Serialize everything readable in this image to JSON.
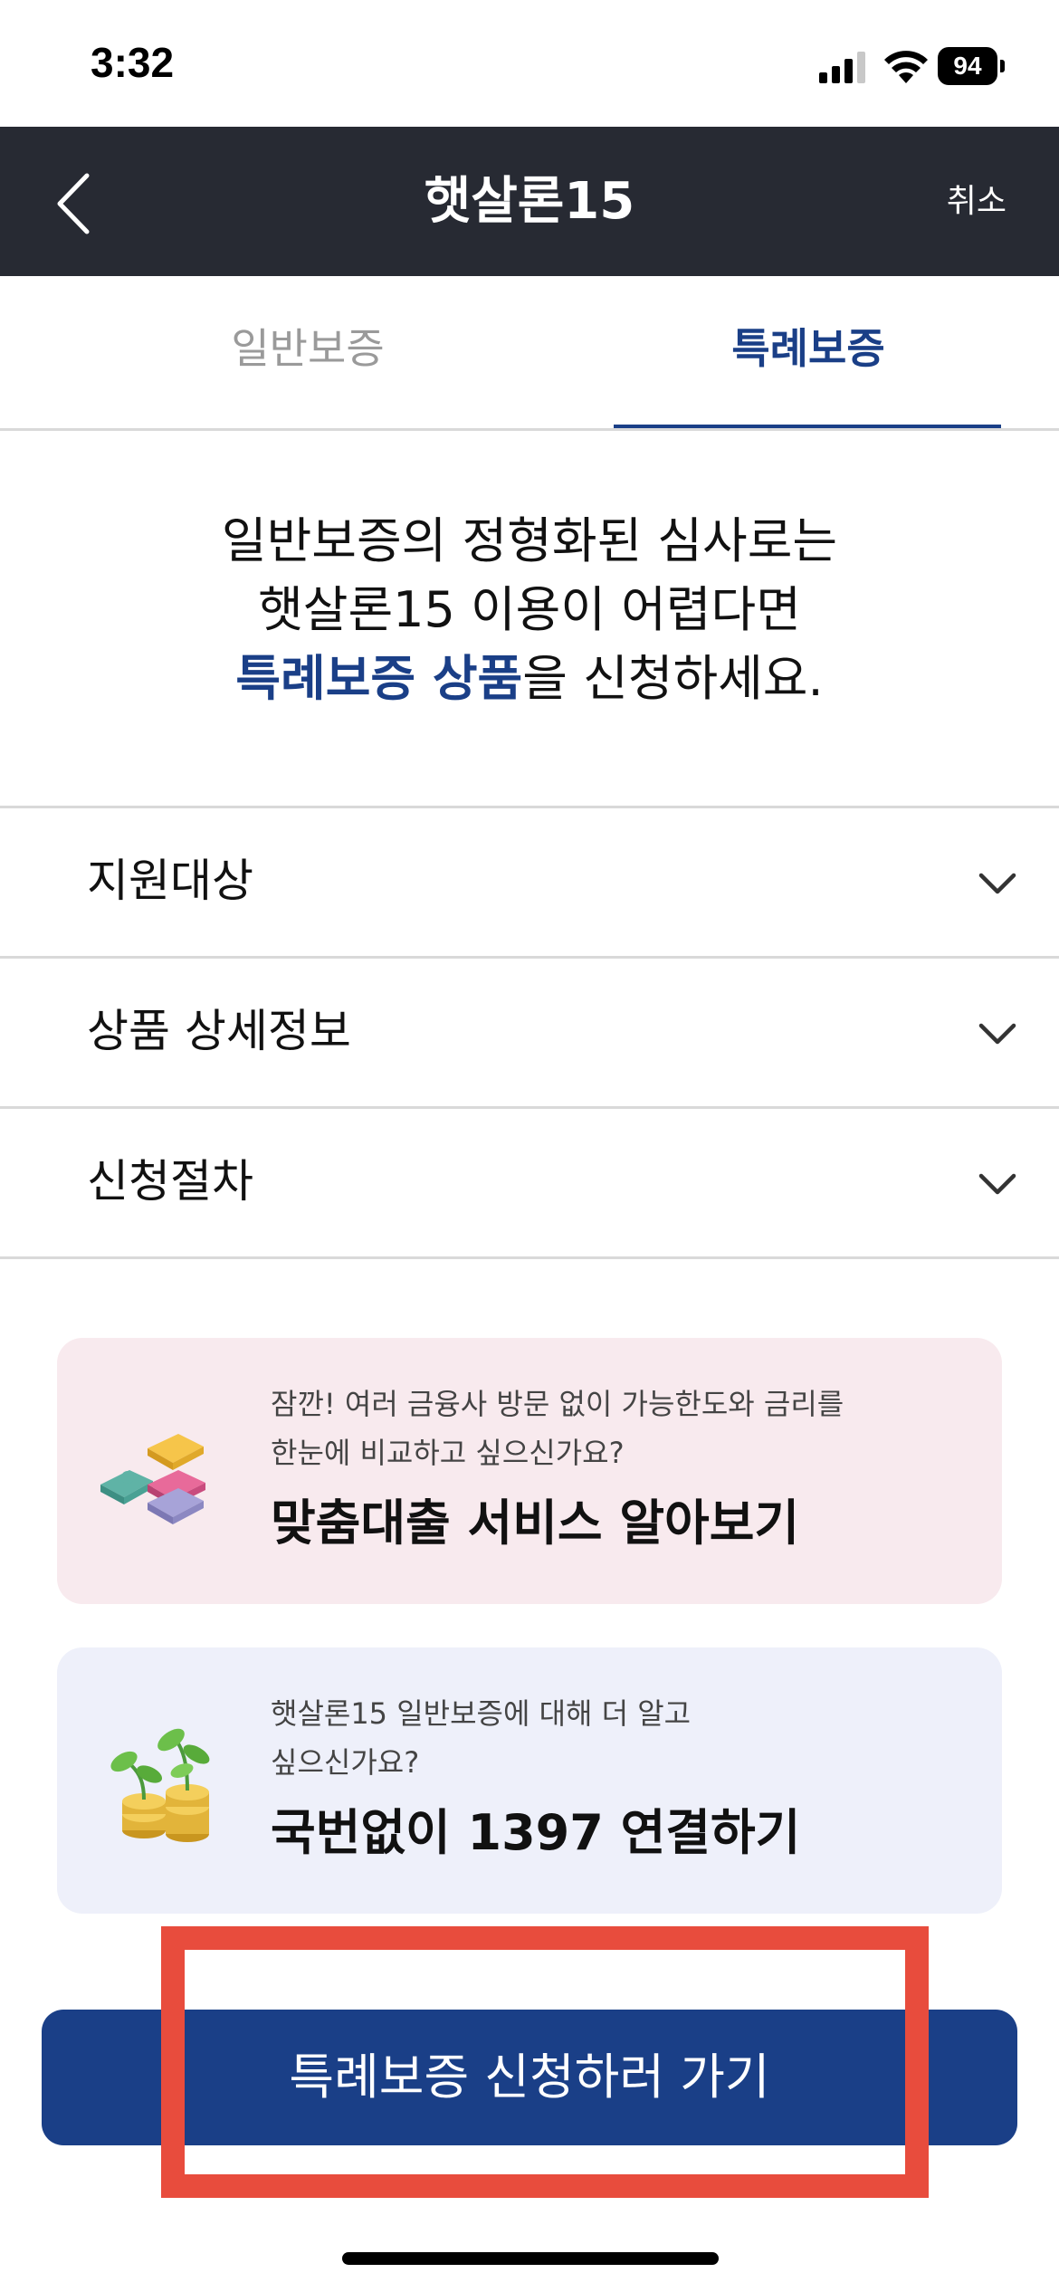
{
  "status_bar": {
    "time": "3:32",
    "battery": "94"
  },
  "header": {
    "title": "햇살론15",
    "cancel_label": "취소",
    "back_icon": "chevron-left-icon"
  },
  "tabs": [
    {
      "label": "일반보증",
      "active": false
    },
    {
      "label": "특례보증",
      "active": true
    }
  ],
  "intro": {
    "line1": "일반보증의 정형화된 심사로는",
    "line2": "햇살론15 이용이 어렵다면",
    "line3_highlight": "특례보증 상품",
    "line3_rest": "을 신청하세요."
  },
  "accordion": [
    {
      "label": "지원대상",
      "icon": "chevron-down-icon"
    },
    {
      "label": "상품 상세정보",
      "icon": "chevron-down-icon"
    },
    {
      "label": "신청절차",
      "icon": "chevron-down-icon"
    }
  ],
  "cards": [
    {
      "sub1": "잠깐! 여러 금융사 방문 없이 가능한도와 금리를",
      "sub2": "한눈에 비교하고 싶으신가요?",
      "title": "맞춤대출 서비스 알아보기",
      "icon": "puzzle-icon",
      "background": "#f8eaee"
    },
    {
      "sub1": "햇살론15 일반보증에 대해 더 알고",
      "sub2": "싶으신가요?",
      "title": "국번없이 1397 연결하기",
      "icon": "money-plant-icon",
      "background": "#eef0fa"
    }
  ],
  "cta": {
    "label": "특례보증 신청하러 가기"
  },
  "colors": {
    "header_bg": "#272a33",
    "accent": "#1a3f87",
    "highlight_box": "#e84c3d"
  }
}
